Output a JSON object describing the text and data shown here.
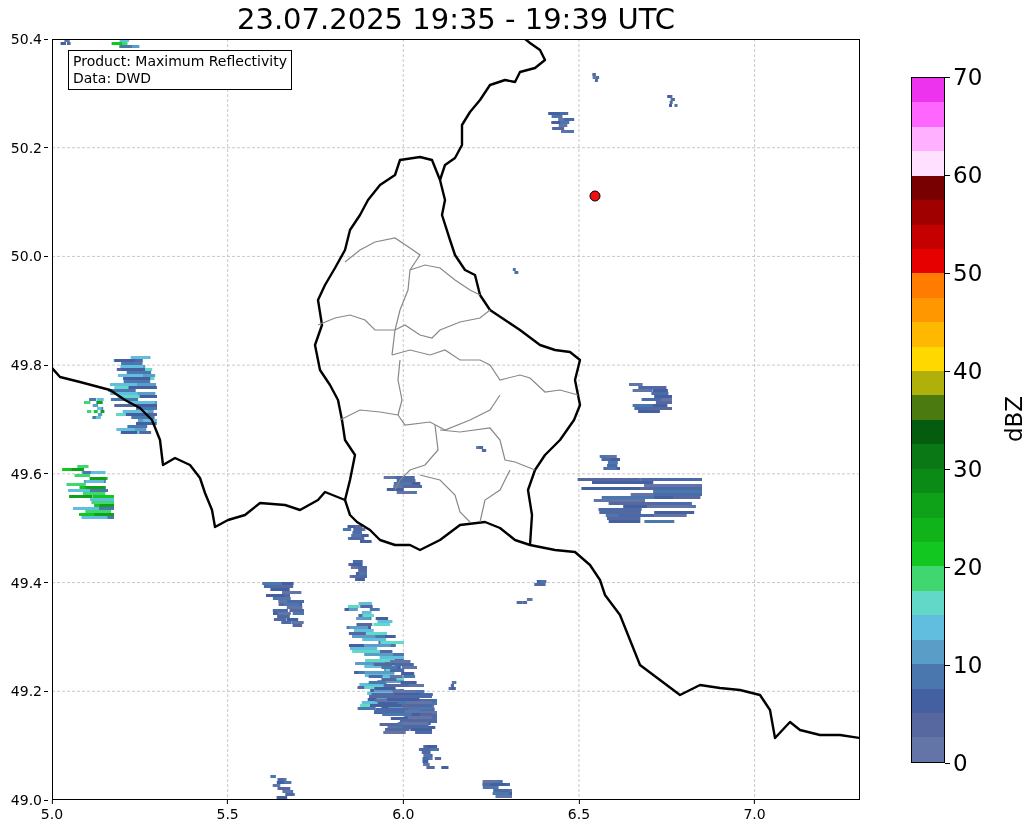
{
  "title": "23.07.2025 19:35 - 19:39 UTC",
  "info_box": {
    "lines": [
      "Product: Maximum Reflectivity",
      "Data: DWD"
    ]
  },
  "map": {
    "x_ticks": [
      "5.0",
      "5.5",
      "6.0",
      "6.5",
      "7.0"
    ],
    "y_ticks": [
      "50.4",
      "50.2",
      "50.0",
      "49.8",
      "49.6",
      "49.4",
      "49.2",
      "49.0"
    ]
  },
  "colorbar": {
    "label": "dBZ",
    "ticks": [
      "70",
      "60",
      "50",
      "40",
      "30",
      "20",
      "10",
      "0"
    ],
    "bands": [
      {
        "color": "#ee33ee"
      },
      {
        "color": "#ff66ff"
      },
      {
        "color": "#ffb0ff"
      },
      {
        "color": "#ffe0ff"
      },
      {
        "color": "#780000"
      },
      {
        "color": "#a00000"
      },
      {
        "color": "#c40000"
      },
      {
        "color": "#e60000"
      },
      {
        "color": "#ff7c00"
      },
      {
        "color": "#ff9800"
      },
      {
        "color": "#ffb800"
      },
      {
        "color": "#ffd800"
      },
      {
        "color": "#b0b00a"
      },
      {
        "color": "#4a7a10"
      },
      {
        "color": "#065c0e"
      },
      {
        "color": "#0a7814"
      },
      {
        "color": "#0c8a16"
      },
      {
        "color": "#0ea218"
      },
      {
        "color": "#10b41a"
      },
      {
        "color": "#12c820"
      },
      {
        "color": "#40d670"
      },
      {
        "color": "#62d8c8"
      },
      {
        "color": "#62bede"
      },
      {
        "color": "#5a9ec8"
      },
      {
        "color": "#4a77ae"
      },
      {
        "color": "#4560a0"
      },
      {
        "color": "#56689f"
      },
      {
        "color": "#6374a6"
      }
    ]
  }
}
